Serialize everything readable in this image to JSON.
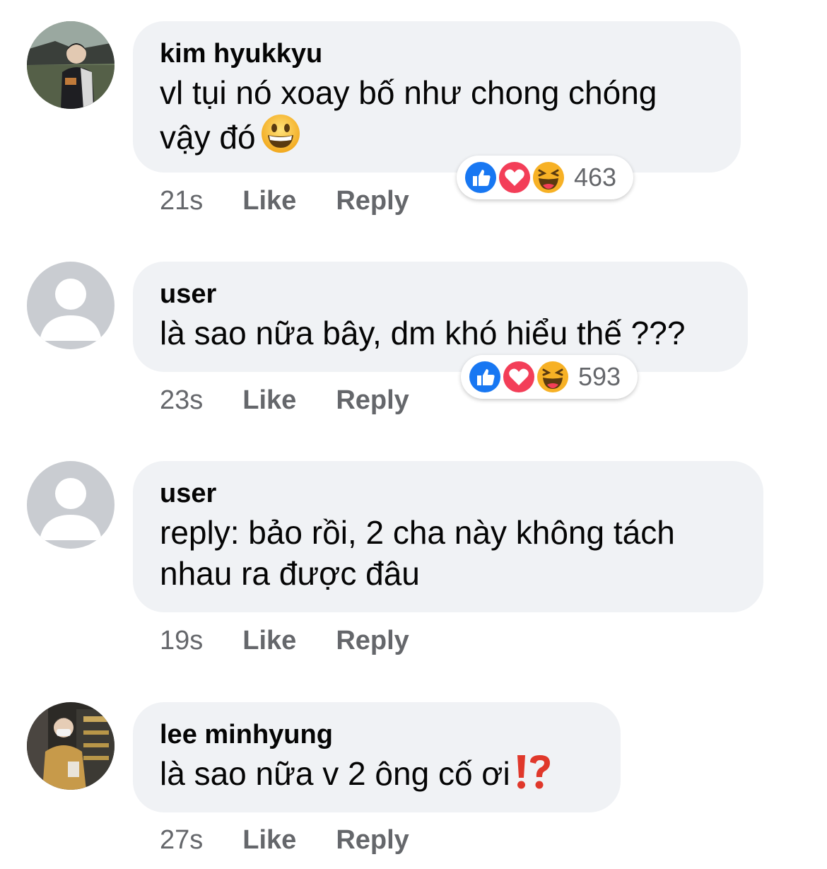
{
  "comments": [
    {
      "author": "kim hyukkyu",
      "text": "vl tụi nó xoay bố như chong chóng vậy đó",
      "emoji": "grinning-face",
      "time": "21s",
      "like_label": "Like",
      "reply_label": "Reply",
      "reaction_count": "463",
      "reactions": [
        "like-icon",
        "love-icon",
        "haha-icon"
      ],
      "avatar": "photo-avatar"
    },
    {
      "author": "user",
      "text": "là sao nữa bây, dm khó hiểu thế ???",
      "time": "23s",
      "like_label": "Like",
      "reply_label": "Reply",
      "reaction_count": "593",
      "reactions": [
        "like-icon",
        "love-icon",
        "haha-icon"
      ],
      "avatar": "default-avatar"
    },
    {
      "author": "user",
      "text": "reply: bảo rồi, 2 cha này không tách nhau ra được đâu",
      "time": "19s",
      "like_label": "Like",
      "reply_label": "Reply",
      "avatar": "default-avatar"
    },
    {
      "author": "lee minhyung",
      "text": "là sao nữa v 2 ông cố ơi",
      "emoji": "exclamation-question-mark",
      "time": "27s",
      "like_label": "Like",
      "reply_label": "Reply",
      "avatar": "photo-avatar"
    }
  ],
  "colors": {
    "bubble": "#f0f2f5",
    "meta_text": "#65676b",
    "like_blue": "#1877f2",
    "love_red": "#f33e58",
    "haha_yellow": "#f7b125"
  }
}
